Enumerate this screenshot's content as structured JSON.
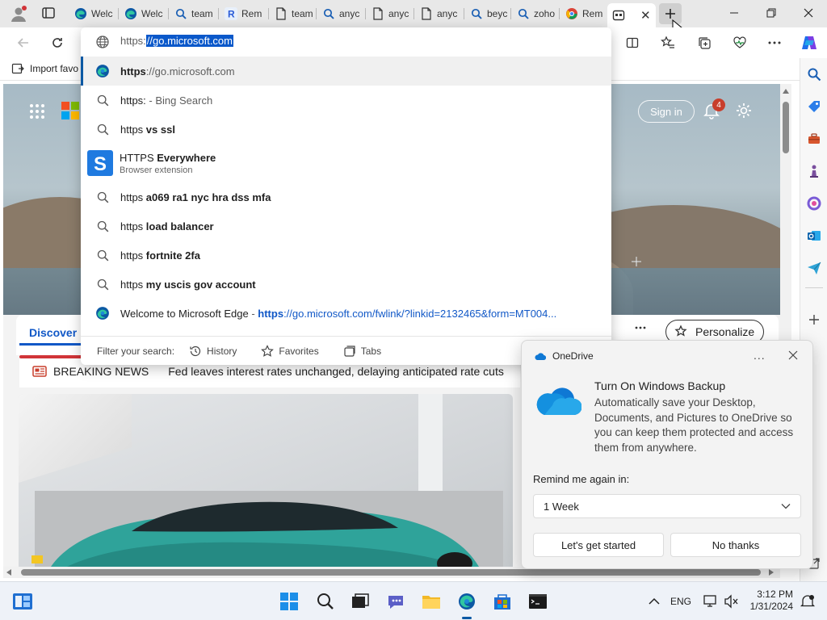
{
  "tabs": [
    {
      "label": "Welc",
      "icon": "edge-icon"
    },
    {
      "label": "Welc",
      "icon": "edge-icon"
    },
    {
      "label": "team",
      "icon": "search-icon"
    },
    {
      "label": "Rem",
      "icon": "r-icon"
    },
    {
      "label": "team",
      "icon": "document-icon"
    },
    {
      "label": "anyc",
      "icon": "search-icon"
    },
    {
      "label": "anyc",
      "icon": "document-icon"
    },
    {
      "label": "anyc",
      "icon": "document-icon"
    },
    {
      "label": "beyc",
      "icon": "search-icon"
    },
    {
      "label": "zoho",
      "icon": "search-icon"
    },
    {
      "label": "Rem",
      "icon": "chrome-like-icon"
    }
  ],
  "address": {
    "scheme": "https:",
    "selected": "//go.microsoft.com"
  },
  "favorites": {
    "import_label": "Import favo"
  },
  "suggestions": [
    {
      "prefix": "https",
      "bold": "://go.microsoft.com",
      "rest": "",
      "type": "edge"
    },
    {
      "prefix": "https:",
      "bold": "",
      "rest": " - Bing Search",
      "type": "search"
    },
    {
      "prefix": "https",
      "bold": " vs ssl",
      "rest": "",
      "type": "search"
    },
    {
      "prefix": "HTTPS",
      "bold": " Everywhere",
      "rest": "",
      "sub": "Browser extension",
      "type": "extension"
    },
    {
      "prefix": "https",
      "bold": " a069 ra1 nyc hra dss mfa",
      "rest": "",
      "type": "search"
    },
    {
      "prefix": "https",
      "bold": " load balancer",
      "rest": "",
      "type": "search"
    },
    {
      "prefix": "https",
      "bold": " fortnite 2fa",
      "rest": "",
      "type": "search"
    },
    {
      "prefix": "https",
      "bold": " my uscis gov account",
      "rest": "",
      "type": "search"
    },
    {
      "prefix": "Welcome to Microsoft Edge",
      "bold": "",
      "rest": " - ",
      "link_bold": "https",
      "link_rest": "://go.microsoft.com/fwlink/?linkid=2132465&form=MT004...",
      "type": "edge"
    }
  ],
  "filter": {
    "label": "Filter your search:",
    "history": "History",
    "favorites": "Favorites",
    "tabs": "Tabs"
  },
  "page": {
    "sign_in": "Sign in",
    "notif_count": "4",
    "discover": "Discover",
    "personalize": "Personalize",
    "breaking_label": "BREAKING NEWS",
    "breaking_text": "Fed leaves interest rates unchanged, delaying anticipated rate cuts"
  },
  "onedrive": {
    "app": "OneDrive",
    "title": "Turn On Windows Backup",
    "body": "Automatically save your Desktop, Documents, and Pictures to OneDrive so you can keep them protected and access them from anywhere.",
    "remind_label": "Remind me again in:",
    "remind_value": "1 Week",
    "primary": "Let's get started",
    "secondary": "No thanks",
    "more": "..."
  },
  "taskbar": {
    "lang": "ENG",
    "time": "3:12 PM",
    "date": "1/31/2024"
  },
  "colors": {
    "accent": "#1158c7",
    "edge_blue": "#0c59a4",
    "notif_badge": "#c83e2c",
    "card_teal": "#2fa39a"
  }
}
